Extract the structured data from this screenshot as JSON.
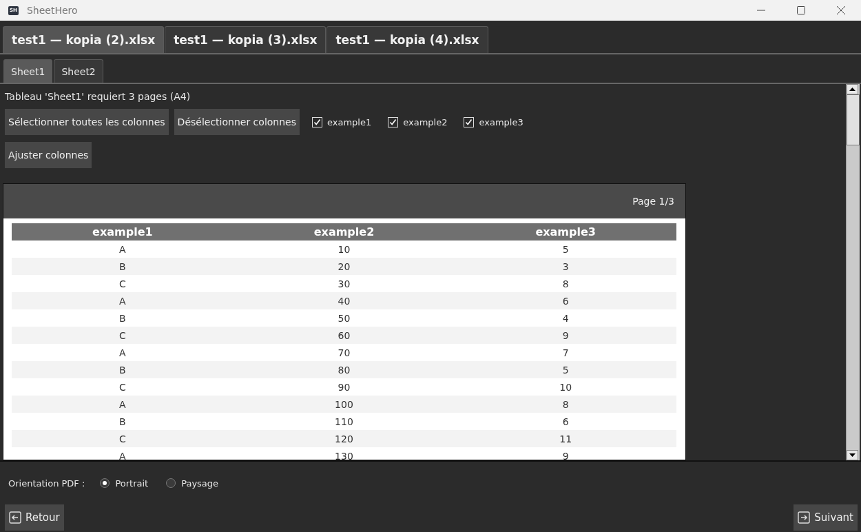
{
  "window": {
    "title": "SheetHero",
    "app_icon": "SH"
  },
  "file_tabs": [
    {
      "label": "test1 — kopia (2).xlsx",
      "selected": true
    },
    {
      "label": "test1 — kopia (3).xlsx",
      "selected": false
    },
    {
      "label": "test1 — kopia (4).xlsx",
      "selected": false
    }
  ],
  "sheet_tabs": [
    {
      "label": "Sheet1",
      "selected": true
    },
    {
      "label": "Sheet2",
      "selected": false
    }
  ],
  "info_text": "Tableau 'Sheet1' requiert 3 pages (A4)",
  "column_buttons": [
    "Sélectionner toutes les colonnes",
    "Désélectionner colonnes"
  ],
  "column_checks": [
    {
      "label": "example1",
      "checked": true
    },
    {
      "label": "example2",
      "checked": true
    },
    {
      "label": "example3",
      "checked": true
    }
  ],
  "adjust_button": "Ajuster colonnes",
  "preview": {
    "page_label": "Page 1/3",
    "columns": [
      "example1",
      "example2",
      "example3"
    ],
    "rows": [
      [
        "A",
        "10",
        "5"
      ],
      [
        "B",
        "20",
        "3"
      ],
      [
        "C",
        "30",
        "8"
      ],
      [
        "A",
        "40",
        "6"
      ],
      [
        "B",
        "50",
        "4"
      ],
      [
        "C",
        "60",
        "9"
      ],
      [
        "A",
        "70",
        "7"
      ],
      [
        "B",
        "80",
        "5"
      ],
      [
        "C",
        "90",
        "10"
      ],
      [
        "A",
        "100",
        "8"
      ],
      [
        "B",
        "110",
        "6"
      ],
      [
        "C",
        "120",
        "11"
      ],
      [
        "A",
        "130",
        "9"
      ]
    ]
  },
  "orientation": {
    "label": "Orientation PDF :",
    "options": [
      {
        "label": "Portrait",
        "selected": true
      },
      {
        "label": "Paysage",
        "selected": false
      }
    ]
  },
  "back_button": "Retour",
  "next_button": "Suivant"
}
